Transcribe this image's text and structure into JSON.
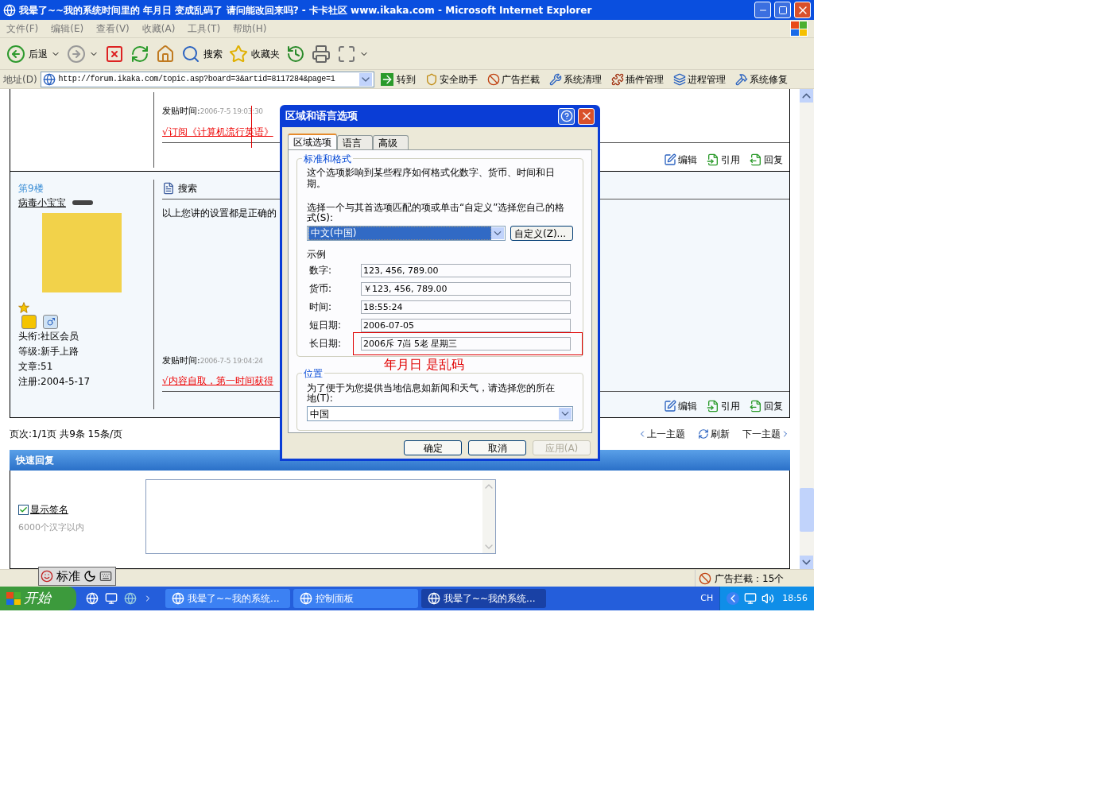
{
  "window": {
    "title": "我晕了~~我的系统时间里的 年月日 变成乱码了 请问能改回来吗? - 卡卡社区 www.ikaka.com - Microsoft Internet Explorer"
  },
  "menu": [
    "文件(F)",
    "编辑(E)",
    "查看(V)",
    "收藏(A)",
    "工具(T)",
    "帮助(H)"
  ],
  "toolbar": [
    {
      "kind": "back",
      "label": "后退",
      "dropdown": true
    },
    {
      "kind": "forward",
      "dropdown": true
    },
    {
      "kind": "stop"
    },
    {
      "kind": "refresh"
    },
    {
      "kind": "home"
    },
    {
      "kind": "search",
      "label": "搜索"
    },
    {
      "kind": "favorites",
      "label": "收藏夹"
    },
    {
      "kind": "history"
    },
    {
      "kind": "print"
    },
    {
      "kind": "window",
      "dropdown": true
    }
  ],
  "address_bar": {
    "label": "地址(D)",
    "url": "http://forum.ikaka.com/topic.asp?board=3&artid=8117284&page=1",
    "go": "转到"
  },
  "links": [
    {
      "kind": "shield",
      "label": "安全助手"
    },
    {
      "kind": "block",
      "label": "广告拦截"
    },
    {
      "kind": "clean",
      "label": "系统清理"
    },
    {
      "kind": "plugin",
      "label": "插件管理"
    },
    {
      "kind": "process",
      "label": "进程管理"
    },
    {
      "kind": "repair",
      "label": "系统修复"
    }
  ],
  "posts": [
    {
      "post_time_label": "发贴时间:",
      "post_time": "2006-7-5 19:03:30",
      "ad_link": "√订阅《计算机流行英语》",
      "actions": [
        "编辑",
        "引用",
        "回复"
      ]
    },
    {
      "floor": "第9楼",
      "author": "病毒小宝宝",
      "title": "搜索",
      "body": "以上您讲的设置都是正确的",
      "details": [
        "头衔:社区会员",
        "等级:新手上路",
        "文章:51",
        "注册:2004-5-17"
      ],
      "post_time_label": "发贴时间:",
      "post_time": "2006-7-5 19:04:24",
      "ad_link": "√内容自取，第一时间获得",
      "actions": [
        "编辑",
        "引用",
        "回复"
      ]
    }
  ],
  "pagination": {
    "info": "页次:1/1页 共9条 15条/页",
    "prev": "上一主题",
    "refresh": "刷新",
    "next": "下一主题"
  },
  "quick_reply": {
    "title": "快速回复",
    "show_signature": {
      "label": "显示签名",
      "checked": true
    },
    "hint": "6000个汉字以内"
  },
  "status_bar": {
    "ime": "标准",
    "adblock": "广告拦截：15个"
  },
  "taskbar": {
    "start": "开始",
    "tasks": [
      {
        "label": "我晕了~~我的系统...",
        "selected": false
      },
      {
        "label": "控制面板",
        "selected": false
      },
      {
        "label": "我晕了~~我的系统...",
        "selected": true
      }
    ],
    "lang": "CH",
    "clock": "18:56"
  },
  "dialog": {
    "title": "区域和语言选项",
    "tabs": [
      {
        "label": "区域选项",
        "selected": true
      },
      {
        "label": "语言",
        "selected": false
      },
      {
        "label": "高级",
        "selected": false
      }
    ],
    "formats_group": "标准和格式",
    "description": "这个选项影响到某些程序如何格式化数字、货币、时间和日期。",
    "prompt": "选择一个与其首选项匹配的项或单击“自定义”选择您自己的格式(S):",
    "format_value": "中文(中国)",
    "customize": "自定义(Z)...",
    "samples_label": "示例",
    "samples": [
      {
        "label": "数字:",
        "value": "123, 456, 789.00",
        "highlighted": false
      },
      {
        "label": "货币:",
        "value": "￥123, 456, 789.00",
        "highlighted": false
      },
      {
        "label": "时间:",
        "value": "18:55:24",
        "highlighted": false
      },
      {
        "label": "短日期:",
        "value": "2006-07-05",
        "highlighted": false
      },
      {
        "label": "长日期:",
        "value": "2006斥 7岿 5老 星期三",
        "highlighted": true
      }
    ],
    "annotation": "年月日  是乱码",
    "location_group": "位置",
    "location_prompt": "为了便于为您提供当地信息如新闻和天气，请选择您的所在地(T):",
    "location_value": "中国",
    "buttons": [
      {
        "label": "确定",
        "disabled": false
      },
      {
        "label": "取消",
        "disabled": false
      },
      {
        "label": "应用(A)",
        "disabled": true
      }
    ]
  }
}
